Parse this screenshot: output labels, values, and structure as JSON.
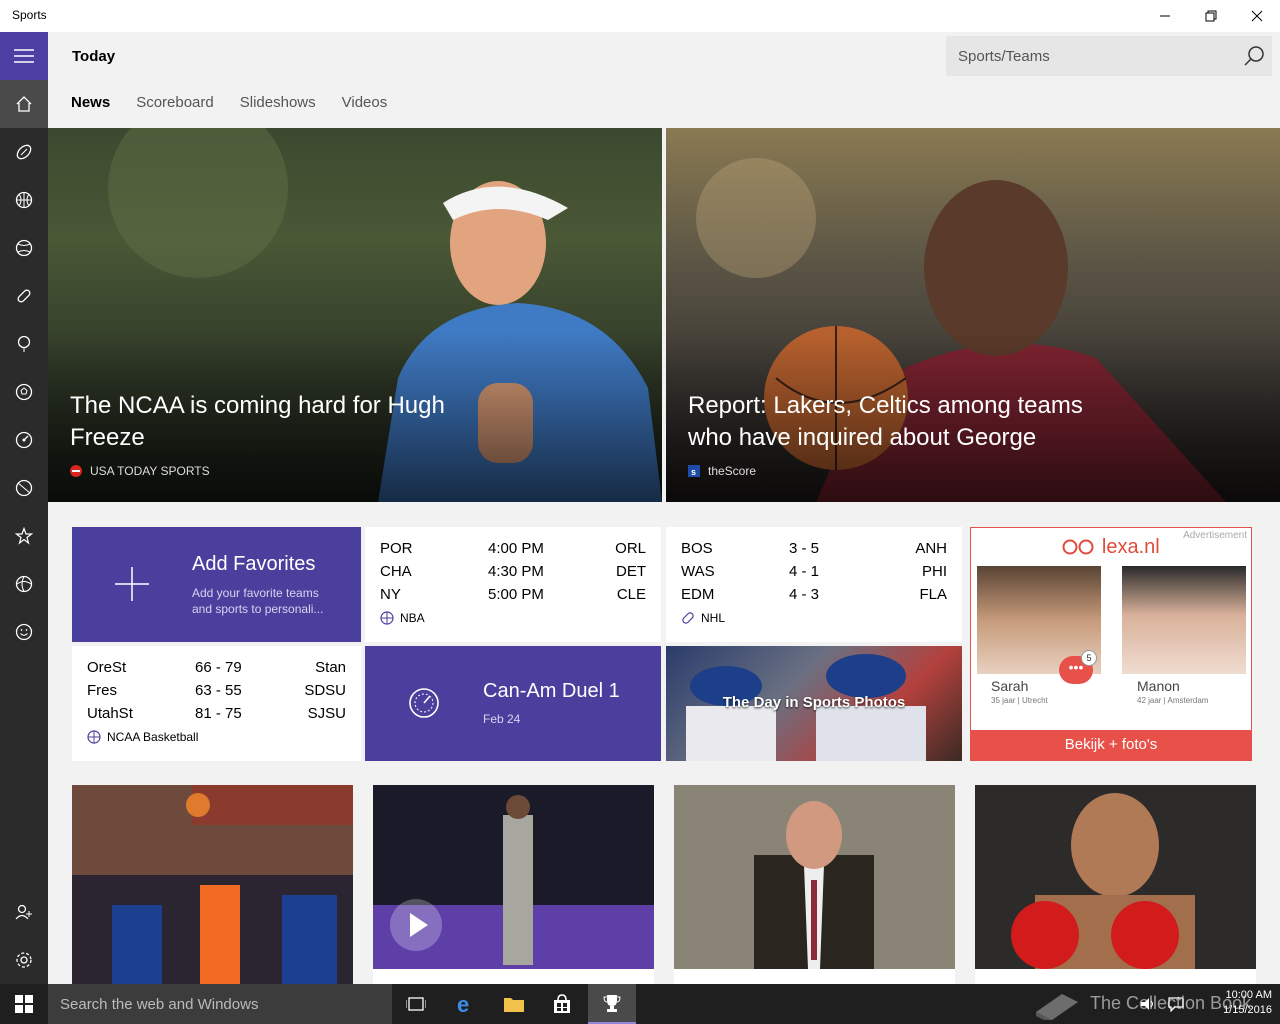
{
  "window": {
    "title": "Sports"
  },
  "header": {
    "page_title": "Today",
    "search_placeholder": "Sports/Teams",
    "tabs": [
      {
        "label": "News",
        "active": true
      },
      {
        "label": "Scoreboard",
        "active": false
      },
      {
        "label": "Slideshows",
        "active": false
      },
      {
        "label": "Videos",
        "active": false
      }
    ]
  },
  "nav_icons": [
    "hamburger-icon",
    "home-icon",
    "football-icon",
    "basketball-icon",
    "baseball-icon",
    "hockey-icon",
    "golf-icon",
    "soccer-icon",
    "racing-icon",
    "tennis-icon",
    "favorites-icon",
    "fantasy-icon",
    "fun-icon",
    "add-user-icon",
    "settings-icon"
  ],
  "hero": {
    "left": {
      "title": "The NCAA is coming hard for Hugh Freeze",
      "source": "USA TODAY SPORTS"
    },
    "right": {
      "title": "Report: Lakers, Celtics among teams who have inquired about George",
      "source": "theScore"
    }
  },
  "add_favorites": {
    "title": "Add Favorites",
    "subtitle": "Add your favorite teams and sports to personali..."
  },
  "nba": {
    "league": "NBA",
    "games": [
      {
        "away": "POR",
        "mid": "4:00 PM",
        "home": "ORL"
      },
      {
        "away": "CHA",
        "mid": "4:30 PM",
        "home": "DET"
      },
      {
        "away": "NY",
        "mid": "5:00 PM",
        "home": "CLE"
      }
    ]
  },
  "nhl": {
    "league": "NHL",
    "games": [
      {
        "away": "BOS",
        "mid": "3  -  5",
        "home": "ANH"
      },
      {
        "away": "WAS",
        "mid": "4  -  1",
        "home": "PHI"
      },
      {
        "away": "EDM",
        "mid": "4  -  3",
        "home": "FLA"
      }
    ]
  },
  "ncaa": {
    "league": "NCAA Basketball",
    "games": [
      {
        "away": "OreSt",
        "mid": "66  -  79",
        "home": "Stan"
      },
      {
        "away": "Fres",
        "mid": "63  -  55",
        "home": "SDSU"
      },
      {
        "away": "UtahSt",
        "mid": "81  -  75",
        "home": "SJSU"
      }
    ]
  },
  "event": {
    "title": "Can-Am Duel 1",
    "date": "Feb 24"
  },
  "photos": {
    "label": "The Day in Sports Photos"
  },
  "ad": {
    "label": "Advertisement",
    "brand": "lexa.nl",
    "person1": {
      "name": "Sarah",
      "meta": "35 jaar | Utrecht"
    },
    "person2": {
      "name": "Manon",
      "meta": "42 jaar | Amsterdam"
    },
    "badge": "5",
    "cta": "Bekijk + foto's"
  },
  "taskbar": {
    "search_placeholder": "Search the web and Windows",
    "time": "10:00 AM",
    "date": "1/15/2016",
    "watermark": "The Collection Book"
  },
  "colors": {
    "accent": "#4b3f9e",
    "nav_bg": "#2b2b2b",
    "ad_red": "#e8514a"
  }
}
